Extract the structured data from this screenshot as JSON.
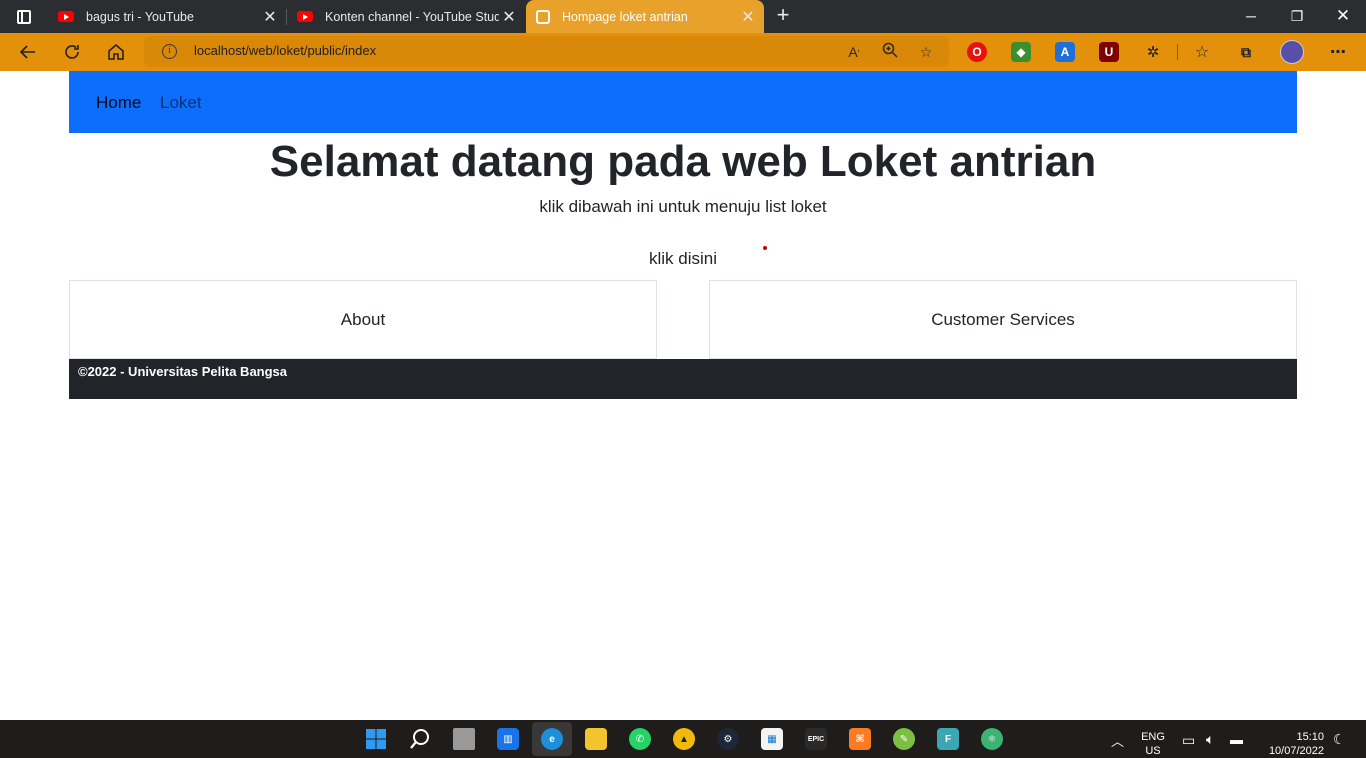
{
  "browser": {
    "tabs": [
      {
        "title": "bagus tri - YouTube",
        "favicon": "youtube-icon"
      },
      {
        "title": "Konten channel - YouTube Studio",
        "favicon": "youtube-icon"
      },
      {
        "title": "Hompage loket antrian",
        "favicon": "xampp-icon",
        "active": true
      }
    ],
    "address": "localhost/web/loket/public/index",
    "accent": "#e3900a"
  },
  "navbar": {
    "home": "Home",
    "loket": "Loket",
    "color": "#0d6efd"
  },
  "hero": {
    "title": "Selamat datang pada web Loket antrian",
    "subtitle": "klik dibawah ini untuk menuju list loket",
    "link": "klik disini"
  },
  "cards": {
    "about": "About",
    "customer_services": "Customer Services"
  },
  "footer": {
    "text": "©2022 - Universitas Pelita Bangsa"
  },
  "taskbar": {
    "lang": "ENG",
    "region": "US",
    "time": "15:10",
    "date": "10/07/2022"
  }
}
